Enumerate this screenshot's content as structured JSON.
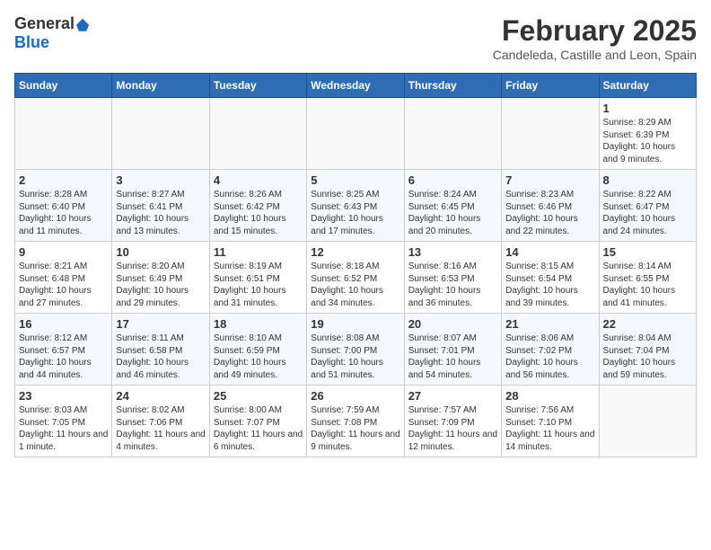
{
  "logo": {
    "general": "General",
    "blue": "Blue"
  },
  "title": {
    "month": "February 2025",
    "location": "Candeleda, Castille and Leon, Spain"
  },
  "weekdays": [
    "Sunday",
    "Monday",
    "Tuesday",
    "Wednesday",
    "Thursday",
    "Friday",
    "Saturday"
  ],
  "weeks": [
    [
      {
        "day": "",
        "info": ""
      },
      {
        "day": "",
        "info": ""
      },
      {
        "day": "",
        "info": ""
      },
      {
        "day": "",
        "info": ""
      },
      {
        "day": "",
        "info": ""
      },
      {
        "day": "",
        "info": ""
      },
      {
        "day": "1",
        "info": "Sunrise: 8:29 AM\nSunset: 6:39 PM\nDaylight: 10 hours and 9 minutes."
      }
    ],
    [
      {
        "day": "2",
        "info": "Sunrise: 8:28 AM\nSunset: 6:40 PM\nDaylight: 10 hours and 11 minutes."
      },
      {
        "day": "3",
        "info": "Sunrise: 8:27 AM\nSunset: 6:41 PM\nDaylight: 10 hours and 13 minutes."
      },
      {
        "day": "4",
        "info": "Sunrise: 8:26 AM\nSunset: 6:42 PM\nDaylight: 10 hours and 15 minutes."
      },
      {
        "day": "5",
        "info": "Sunrise: 8:25 AM\nSunset: 6:43 PM\nDaylight: 10 hours and 17 minutes."
      },
      {
        "day": "6",
        "info": "Sunrise: 8:24 AM\nSunset: 6:45 PM\nDaylight: 10 hours and 20 minutes."
      },
      {
        "day": "7",
        "info": "Sunrise: 8:23 AM\nSunset: 6:46 PM\nDaylight: 10 hours and 22 minutes."
      },
      {
        "day": "8",
        "info": "Sunrise: 8:22 AM\nSunset: 6:47 PM\nDaylight: 10 hours and 24 minutes."
      }
    ],
    [
      {
        "day": "9",
        "info": "Sunrise: 8:21 AM\nSunset: 6:48 PM\nDaylight: 10 hours and 27 minutes."
      },
      {
        "day": "10",
        "info": "Sunrise: 8:20 AM\nSunset: 6:49 PM\nDaylight: 10 hours and 29 minutes."
      },
      {
        "day": "11",
        "info": "Sunrise: 8:19 AM\nSunset: 6:51 PM\nDaylight: 10 hours and 31 minutes."
      },
      {
        "day": "12",
        "info": "Sunrise: 8:18 AM\nSunset: 6:52 PM\nDaylight: 10 hours and 34 minutes."
      },
      {
        "day": "13",
        "info": "Sunrise: 8:16 AM\nSunset: 6:53 PM\nDaylight: 10 hours and 36 minutes."
      },
      {
        "day": "14",
        "info": "Sunrise: 8:15 AM\nSunset: 6:54 PM\nDaylight: 10 hours and 39 minutes."
      },
      {
        "day": "15",
        "info": "Sunrise: 8:14 AM\nSunset: 6:55 PM\nDaylight: 10 hours and 41 minutes."
      }
    ],
    [
      {
        "day": "16",
        "info": "Sunrise: 8:12 AM\nSunset: 6:57 PM\nDaylight: 10 hours and 44 minutes."
      },
      {
        "day": "17",
        "info": "Sunrise: 8:11 AM\nSunset: 6:58 PM\nDaylight: 10 hours and 46 minutes."
      },
      {
        "day": "18",
        "info": "Sunrise: 8:10 AM\nSunset: 6:59 PM\nDaylight: 10 hours and 49 minutes."
      },
      {
        "day": "19",
        "info": "Sunrise: 8:08 AM\nSunset: 7:00 PM\nDaylight: 10 hours and 51 minutes."
      },
      {
        "day": "20",
        "info": "Sunrise: 8:07 AM\nSunset: 7:01 PM\nDaylight: 10 hours and 54 minutes."
      },
      {
        "day": "21",
        "info": "Sunrise: 8:06 AM\nSunset: 7:02 PM\nDaylight: 10 hours and 56 minutes."
      },
      {
        "day": "22",
        "info": "Sunrise: 8:04 AM\nSunset: 7:04 PM\nDaylight: 10 hours and 59 minutes."
      }
    ],
    [
      {
        "day": "23",
        "info": "Sunrise: 8:03 AM\nSunset: 7:05 PM\nDaylight: 11 hours and 1 minute."
      },
      {
        "day": "24",
        "info": "Sunrise: 8:02 AM\nSunset: 7:06 PM\nDaylight: 11 hours and 4 minutes."
      },
      {
        "day": "25",
        "info": "Sunrise: 8:00 AM\nSunset: 7:07 PM\nDaylight: 11 hours and 6 minutes."
      },
      {
        "day": "26",
        "info": "Sunrise: 7:59 AM\nSunset: 7:08 PM\nDaylight: 11 hours and 9 minutes."
      },
      {
        "day": "27",
        "info": "Sunrise: 7:57 AM\nSunset: 7:09 PM\nDaylight: 11 hours and 12 minutes."
      },
      {
        "day": "28",
        "info": "Sunrise: 7:56 AM\nSunset: 7:10 PM\nDaylight: 11 hours and 14 minutes."
      },
      {
        "day": "",
        "info": ""
      }
    ]
  ]
}
